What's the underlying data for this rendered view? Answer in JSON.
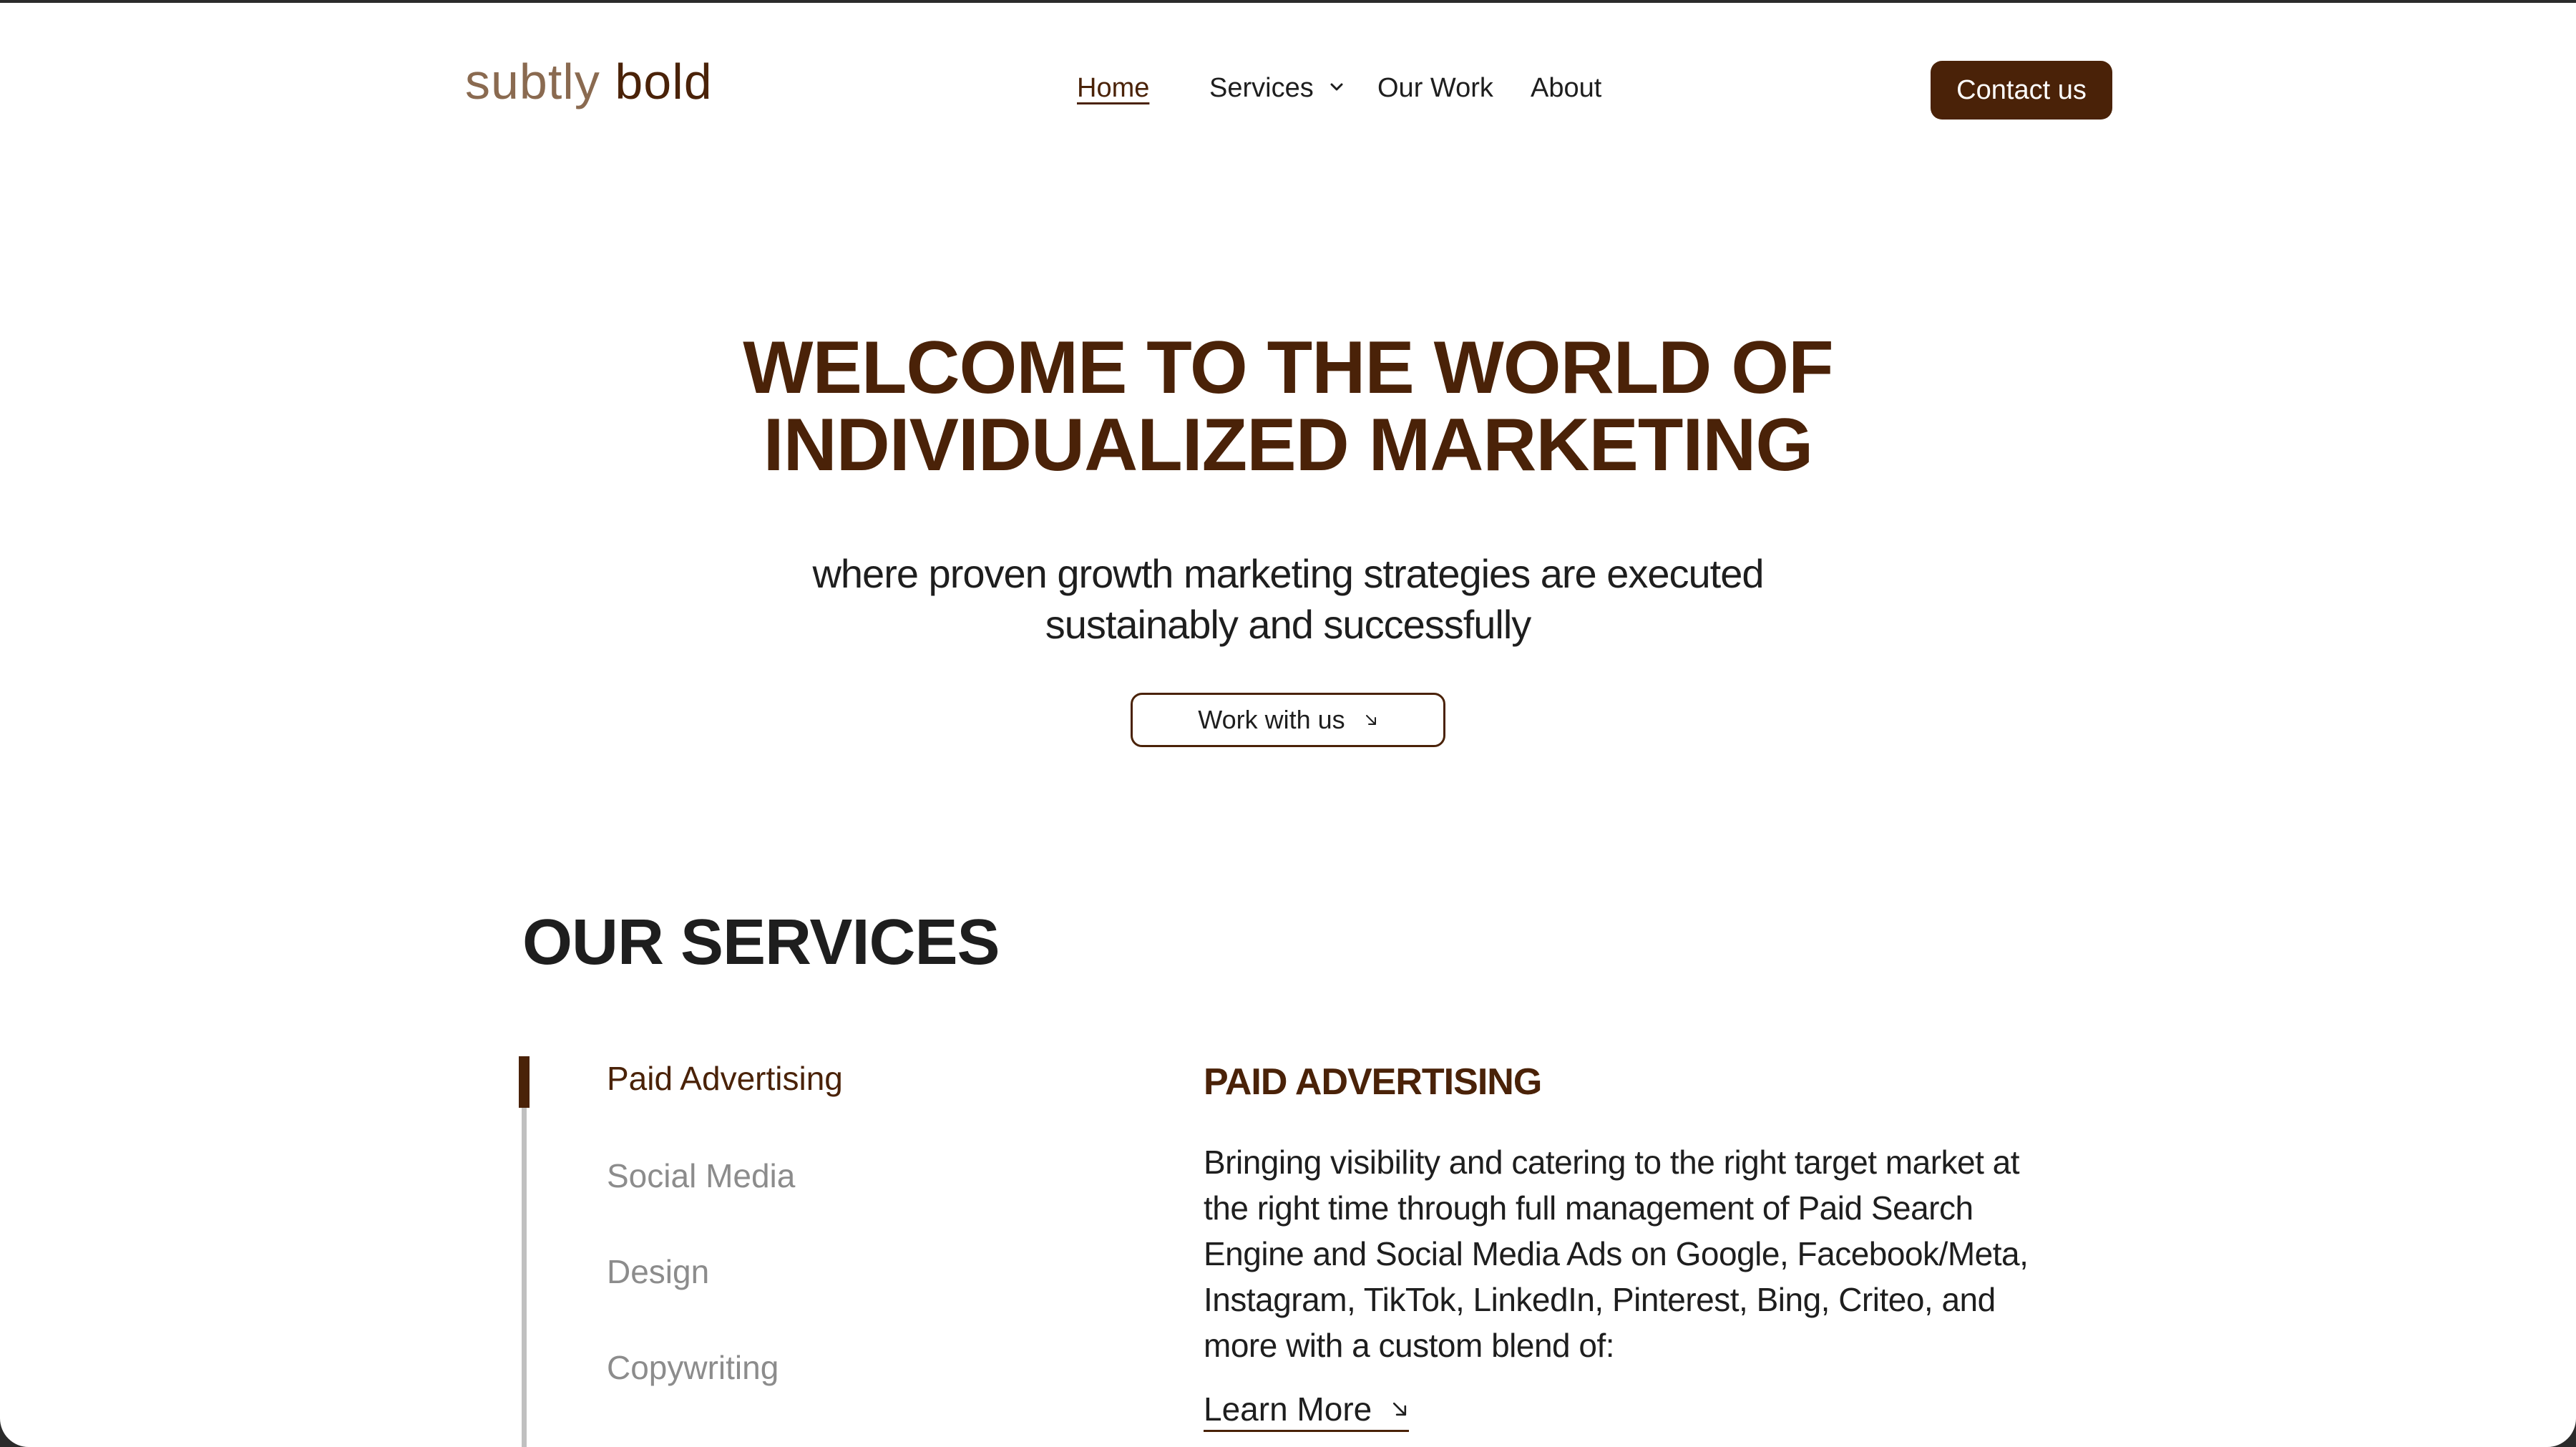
{
  "header": {
    "logo_part1": "subtly",
    "logo_part2": "bold",
    "nav": {
      "home": "Home",
      "services": "Services",
      "our_work": "Our Work",
      "about": "About"
    },
    "contact_label": "Contact us"
  },
  "hero": {
    "title_line1": "WELCOME TO THE WORLD OF",
    "title_line2": "INDIVIDUALIZED MARKETING",
    "subtitle_line1": "where proven growth marketing strategies are executed",
    "subtitle_line2": "sustainably and successfully",
    "cta_label": "Work with us"
  },
  "services": {
    "title": "OUR SERVICES",
    "items": [
      {
        "label": "Paid Advertising",
        "active": true
      },
      {
        "label": "Social Media",
        "active": false
      },
      {
        "label": "Design",
        "active": false
      },
      {
        "label": "Copywriting",
        "active": false
      }
    ],
    "detail": {
      "heading": "PAID ADVERTISING",
      "description": "Bringing visibility and catering to the right target market at the right time through full management of Paid Search Engine and Social Media Ads on Google, Facebook/Meta, Instagram, TikTok, LinkedIn, Pinterest, Bing, Criteo, and more with a custom blend of:",
      "learn_more": "Learn More"
    }
  },
  "colors": {
    "brand_brown": "#4a2208",
    "logo_light": "#8a6a50",
    "highlight": "#e8e2d6",
    "muted_text": "#8c8c8c"
  },
  "icons": {
    "nav_services": "chevron-down-icon",
    "cta": "arrow-down-right-icon",
    "learn_more": "arrow-down-right-icon"
  }
}
